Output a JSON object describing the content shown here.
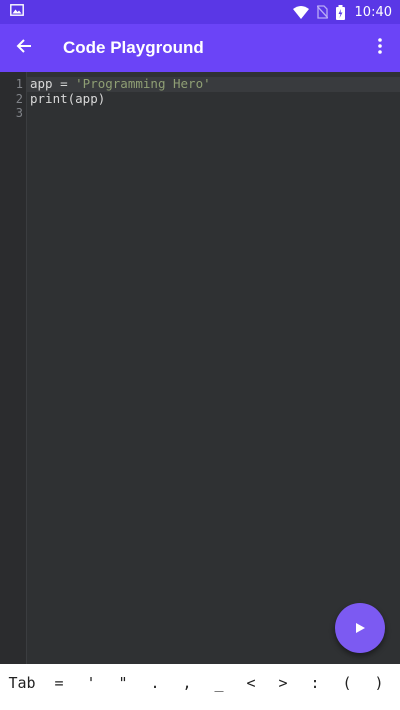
{
  "status_bar": {
    "time": "10:40",
    "icons": [
      "image-icon",
      "wifi-icon",
      "no-sim-icon",
      "battery-icon"
    ]
  },
  "app_bar": {
    "title": "Code Playground",
    "back_icon": "arrow-left-icon",
    "menu_icon": "more-vert-icon"
  },
  "editor": {
    "line_numbers": [
      "1",
      "2",
      "3"
    ],
    "lines": [
      {
        "code": "app = ",
        "string": "'Programming Hero'"
      },
      {
        "code": "print(app)",
        "string": ""
      },
      {
        "code": "",
        "string": ""
      }
    ]
  },
  "fab": {
    "icon": "play-icon"
  },
  "symbol_bar": {
    "keys": [
      "Tab",
      "=",
      "'",
      "\"",
      ".",
      ",",
      "_",
      "<",
      ">",
      ":",
      "(",
      ")"
    ]
  },
  "colors": {
    "status_bar": "#5a37e6",
    "app_bar": "#6b44f7",
    "editor_bg": "#2f3133",
    "fab": "#7c5af2",
    "string_literal": "#8f9f74"
  }
}
